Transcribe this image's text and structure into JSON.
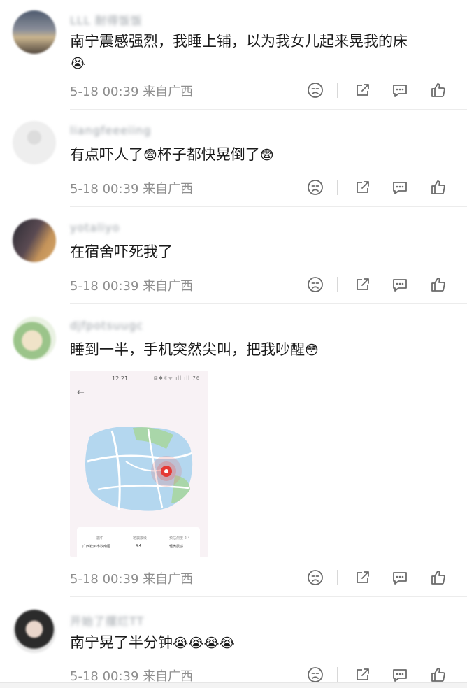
{
  "comments": [
    {
      "name": "LLL 耐得饭饭",
      "text": "南宁震感强烈，我睡上铺，以为我女儿起来晃我的床",
      "emoji": "😭",
      "time": "5-18 00:39",
      "location": "来自广西"
    },
    {
      "name": "liangfeeeiing",
      "text": "有点吓人了",
      "emoji": "😨",
      "text2": "杯子都快晃倒了",
      "emoji2": "😨",
      "time": "5-18 00:39",
      "location": "来自广西"
    },
    {
      "name": "yotaliyo",
      "text": "在宿舍吓死我了",
      "time": "5-18 00:39",
      "location": "来自广西"
    },
    {
      "name": "djfpotsuugc",
      "text": "睡到一半，手机突然尖叫，把我吵醒",
      "emoji": "😳",
      "time": "5-18 00:39",
      "location": "来自广西",
      "image": {
        "status_time": "12:21",
        "status_icons": "⊠✱✳ᯤ ıll ıll 76",
        "back_arrow": "←",
        "info_labels": [
          "震中",
          "地震震级",
          "预估烈度 2.4"
        ],
        "info_values": [
          "广西钦州市钦南区",
          "4.4",
          "轻微震感"
        ]
      }
    },
    {
      "name": "开始了摆烂TT",
      "text": "南宁晃了半分钟",
      "emoji": "😭😭😭😭",
      "time": "5-18 00:39",
      "location": "来自广西"
    }
  ],
  "icons": {
    "dislike": "dislike-face-icon",
    "share": "share-icon",
    "comment": "comment-icon",
    "like": "thumbs-up-icon"
  }
}
